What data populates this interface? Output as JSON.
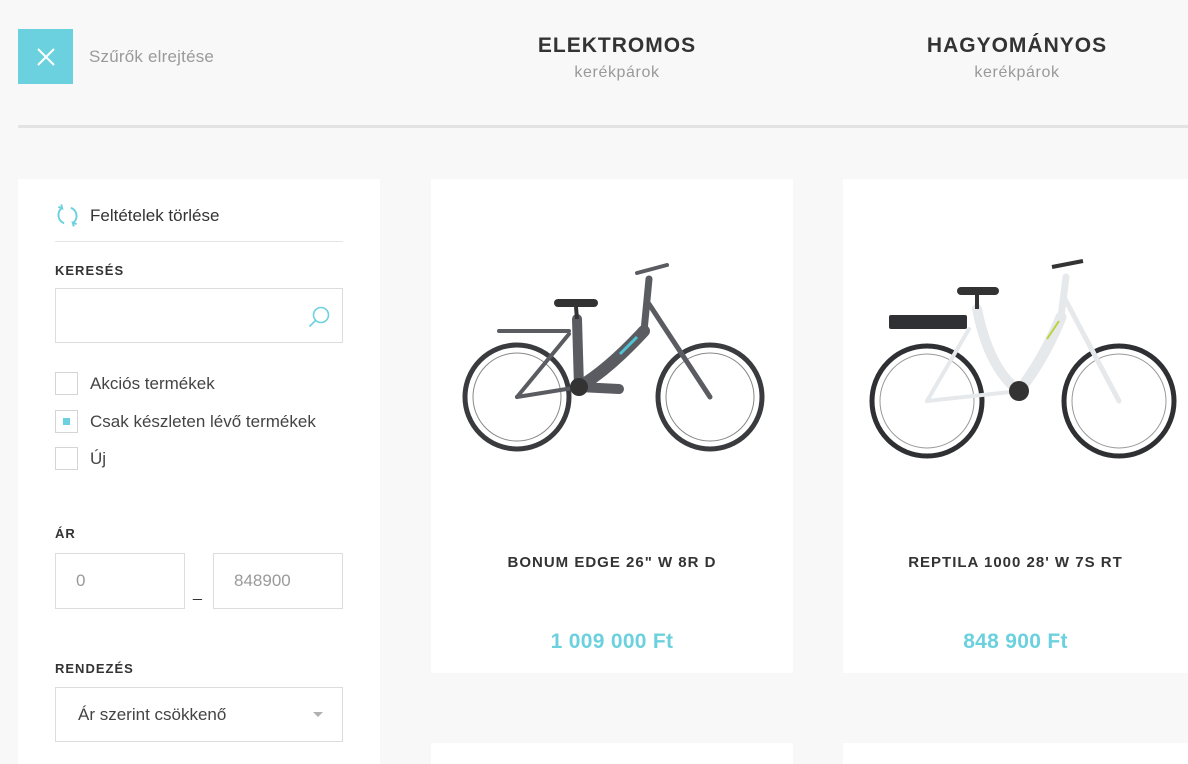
{
  "header": {
    "hide_filters_label": "Szűrők elrejtése",
    "categories": [
      {
        "title": "ELEKTROMOS",
        "subtitle": "kerékpárok"
      },
      {
        "title": "HAGYOMÁNYOS",
        "subtitle": "kerékpárok"
      }
    ]
  },
  "sidebar": {
    "reset_label": "Feltételek törlése",
    "search": {
      "label": "KERESÉS",
      "value": "",
      "placeholder": ""
    },
    "checkboxes": [
      {
        "label": "Akciós termékek",
        "checked": false
      },
      {
        "label": "Csak készleten lévő termékek",
        "checked": true
      },
      {
        "label": "Új",
        "checked": false
      }
    ],
    "price": {
      "label": "ÁR",
      "min": "0",
      "separator": "_",
      "max": "848900"
    },
    "sort": {
      "label": "RENDEZÉS",
      "value": "Ár szerint csökkenő"
    }
  },
  "products": [
    {
      "name": "BONUM EDGE 26\" W 8R D",
      "price": "1 009 000 Ft",
      "frame_color": "#5a5c61"
    },
    {
      "name": "REPTILA 1000 28' W 7S RT",
      "price": "848 900 Ft",
      "frame_color": "#e6e9ec"
    }
  ],
  "colors": {
    "accent": "#6cd1de",
    "text": "#333333",
    "muted": "#9a9a9a"
  }
}
